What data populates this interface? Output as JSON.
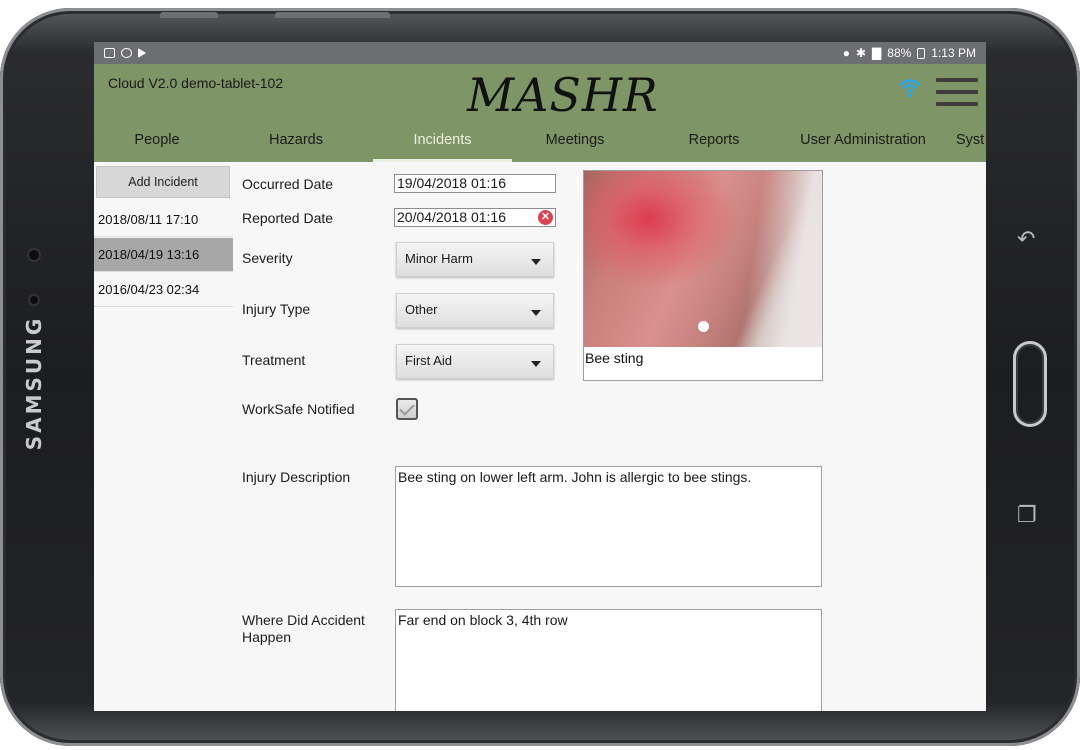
{
  "device": {
    "brand": "SAMSUNG"
  },
  "status_bar": {
    "battery": "88%",
    "time": "1:13 PM"
  },
  "app": {
    "device_name": "Cloud V2.0 demo-tablet-102",
    "logo": "MASHR",
    "icons": [
      "wifi-icon",
      "hamburger-menu-icon"
    ],
    "accent_color": "#7e9566"
  },
  "tabs": [
    {
      "label": "People"
    },
    {
      "label": "Hazards"
    },
    {
      "label": "Incidents",
      "active": true
    },
    {
      "label": "Meetings"
    },
    {
      "label": "Reports"
    },
    {
      "label": "User Administration"
    },
    {
      "label": "Syst"
    }
  ],
  "sidebar": {
    "add_button": "Add Incident",
    "incidents": [
      {
        "datetime": "2018/08/11 17:10"
      },
      {
        "datetime": "2018/04/19 13:16",
        "selected": true
      },
      {
        "datetime": "2016/04/23 02:34"
      }
    ]
  },
  "form": {
    "occurred_date": {
      "label": "Occurred Date",
      "value": "19/04/2018 01:16"
    },
    "reported_date": {
      "label": "Reported Date",
      "value": "20/04/2018 01:16"
    },
    "severity": {
      "label": "Severity",
      "value": "Minor Harm"
    },
    "injury_type": {
      "label": "Injury Type",
      "value": "Other"
    },
    "treatment": {
      "label": "Treatment",
      "value": "First Aid"
    },
    "worksafe_notified": {
      "label": "WorkSafe Notified",
      "checked": true
    },
    "injury_description": {
      "label": "Injury Description",
      "value": "Bee sting on lower left arm. John is allergic to bee stings."
    },
    "accident_location": {
      "label_line1": "Where Did Accident",
      "label_line2": "Happen",
      "value": "Far end on block 3, 4th row"
    }
  },
  "photo": {
    "caption": "Bee sting"
  }
}
